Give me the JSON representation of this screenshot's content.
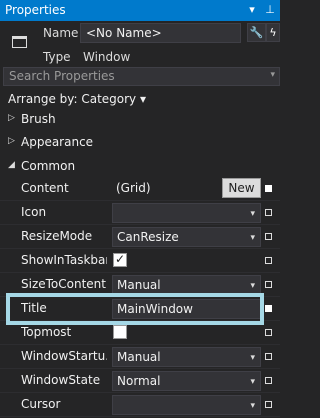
{
  "window": {
    "title": "Properties",
    "pin_glyph": "▾",
    "dock_glyph": "⊥"
  },
  "header": {
    "name_label": "Name",
    "name_value": "<No Name>",
    "type_label": "Type",
    "type_value": "Window",
    "wrench_glyph": "🔧",
    "lightning_glyph": "ϟ"
  },
  "search": {
    "placeholder": "Search Properties",
    "arrow": "▾"
  },
  "arrange": {
    "label": "Arrange by: Category ▾"
  },
  "categories": {
    "brush": {
      "label": "Brush",
      "glyph": "▷"
    },
    "appearance": {
      "label": "Appearance",
      "glyph": "▷"
    },
    "common": {
      "label": "Common",
      "glyph": "◢"
    }
  },
  "properties": [
    {
      "label": "Content",
      "value": "(Grid)",
      "button": "New"
    },
    {
      "label": "Icon",
      "value": ""
    },
    {
      "label": "ResizeMode",
      "value": "CanResize"
    },
    {
      "label": "ShowInTaskbar",
      "checked": true
    },
    {
      "label": "SizeToContent",
      "value": "Manual"
    },
    {
      "label": "Title",
      "value": "MainWindow"
    },
    {
      "label": "Topmost",
      "checked": false
    },
    {
      "label": "WindowStartu...",
      "value": "Manual"
    },
    {
      "label": "WindowState",
      "value": "Normal"
    },
    {
      "label": "Cursor",
      "value": ""
    }
  ],
  "colors": {
    "accent": "#007acc",
    "background": "#252526",
    "highlight": "#a5d8e6"
  }
}
